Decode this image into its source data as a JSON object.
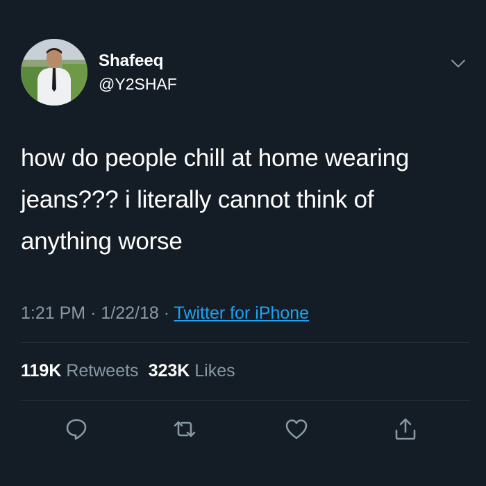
{
  "user": {
    "display_name": "Shafeeq",
    "handle": "@Y2SHAF"
  },
  "tweet": {
    "text": "how do people chill at home wearing jeans??? i literally cannot think of anything worse"
  },
  "meta": {
    "time": "1:21 PM",
    "date": "1/22/18",
    "separator": "·",
    "source": "Twitter for iPhone"
  },
  "stats": {
    "retweets_count": "119K",
    "retweets_label": "Retweets",
    "likes_count": "323K",
    "likes_label": "Likes"
  },
  "icons": {
    "menu": "chevron-down-icon",
    "reply": "reply-icon",
    "retweet": "retweet-icon",
    "like": "heart-icon",
    "share": "share-icon"
  },
  "colors": {
    "background": "#141d26",
    "secondary_text": "#8899a6",
    "link": "#1da1f2",
    "icon": "#8899a6"
  }
}
